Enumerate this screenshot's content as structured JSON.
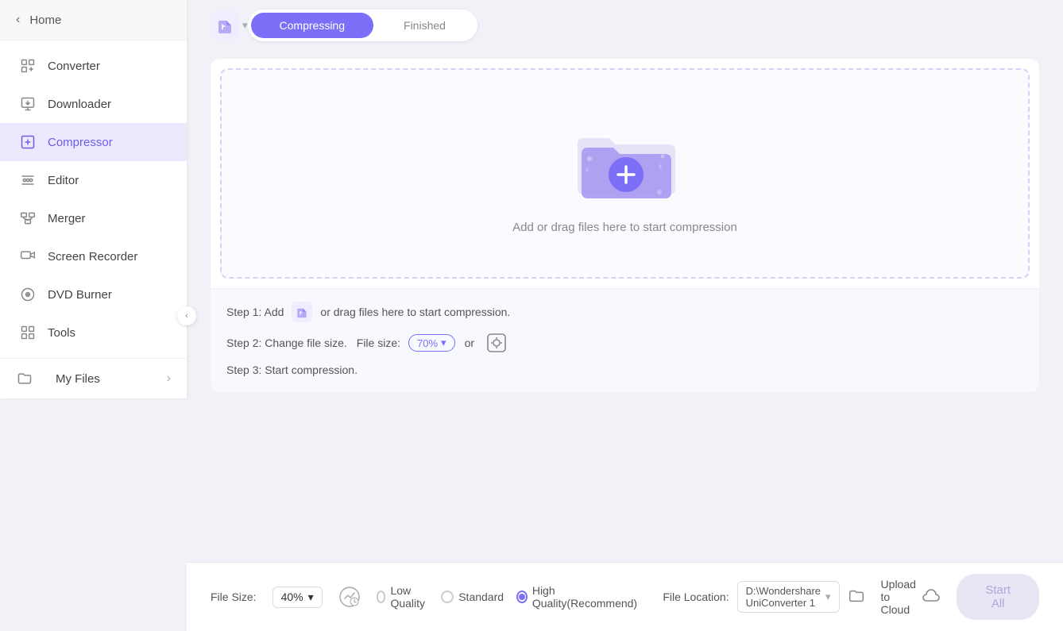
{
  "sidebar": {
    "home_label": "Home",
    "collapse_label": "◀",
    "items": [
      {
        "id": "converter",
        "label": "Converter",
        "icon": "converter-icon"
      },
      {
        "id": "downloader",
        "label": "Downloader",
        "icon": "downloader-icon"
      },
      {
        "id": "compressor",
        "label": "Compressor",
        "icon": "compressor-icon",
        "active": true
      },
      {
        "id": "editor",
        "label": "Editor",
        "icon": "editor-icon"
      },
      {
        "id": "merger",
        "label": "Merger",
        "icon": "merger-icon"
      },
      {
        "id": "screen-recorder",
        "label": "Screen Recorder",
        "icon": "recorder-icon"
      },
      {
        "id": "dvd-burner",
        "label": "DVD Burner",
        "icon": "dvd-icon"
      },
      {
        "id": "tools",
        "label": "Tools",
        "icon": "tools-icon"
      }
    ],
    "footer": {
      "label": "My Files",
      "arrow": "›"
    }
  },
  "header": {
    "logo_dropdown": "▾"
  },
  "tabs": {
    "compressing": "Compressing",
    "finished": "Finished"
  },
  "dropzone": {
    "text": "Add or drag files here to start compression"
  },
  "steps": {
    "step1_prefix": "Step 1: Add",
    "step1_suffix": "or drag files here to start compression.",
    "step2_prefix": "Step 2: Change file size.",
    "step2_file_size_label": "File size:",
    "step2_file_size_value": "70%",
    "step2_or": "or",
    "step3": "Step 3: Start compression."
  },
  "bottom": {
    "file_size_label": "File Size:",
    "file_size_value": "40%",
    "quality_options": [
      {
        "id": "low",
        "label": "Low Quality",
        "checked": false
      },
      {
        "id": "standard",
        "label": "Standard",
        "checked": false
      },
      {
        "id": "high",
        "label": "High Quality(Recommend)",
        "checked": true
      }
    ],
    "file_location_label": "File Location:",
    "file_location_path": "D:\\Wondershare UniConverter 1",
    "upload_to_cloud": "Upload to Cloud",
    "start_all": "Start All"
  },
  "colors": {
    "accent": "#7c6ff7",
    "active_bg": "#ece9ff",
    "active_text": "#6c5ce7"
  }
}
